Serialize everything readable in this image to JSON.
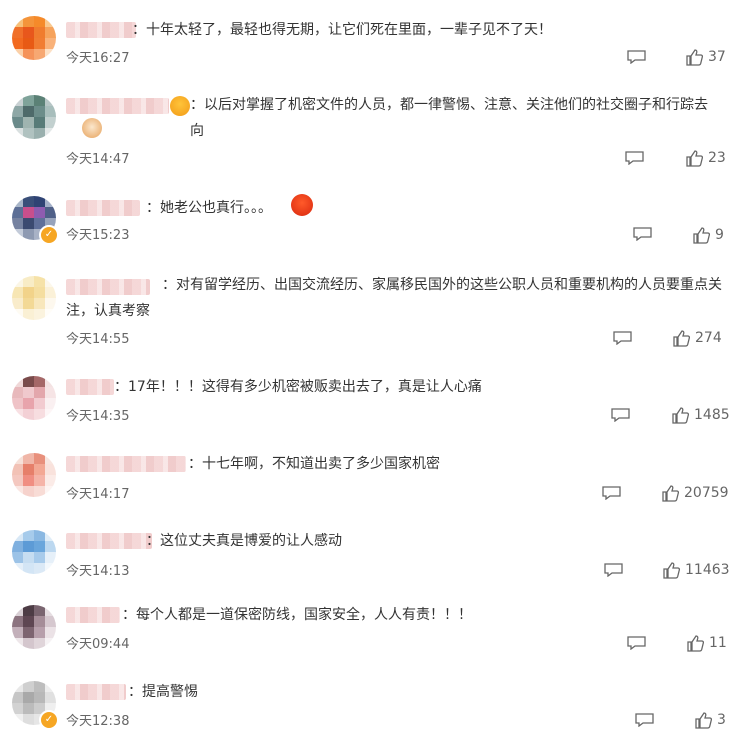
{
  "comments": [
    {
      "text": "：十年太轻了，最轻也得无期，让它们死在里面，一辈子见不了天！",
      "time": "今天16:27",
      "likes": "37"
    },
    {
      "text": "：以后对掌握了机密文件的人员，都一律警惕、注意、关注他们的社交圈子和行踪去向",
      "time": "今天14:47",
      "likes": "23"
    },
    {
      "text": "：她老公也真行。。。",
      "time": "今天15:23",
      "likes": "9"
    },
    {
      "text": "：对有留学经历、出国交流经历、家属移民国外的这些公职人员和重要机构的人员要重点关注，认真考察",
      "time": "今天14:55",
      "likes": "274"
    },
    {
      "text": "：17年！！！这得有多少机密被贩卖出去了，真是让人心痛",
      "time": "今天14:35",
      "likes": "1485"
    },
    {
      "text": "：十七年啊，不知道出卖了多少国家机密",
      "time": "今天14:17",
      "likes": "20759"
    },
    {
      "text": "：这位丈夫真是博爱的让人感动",
      "time": "今天14:13",
      "likes": "11463"
    },
    {
      "text": "：每个人都是一道保密防线，国家安全，人人有责！！！",
      "time": "今天09:44",
      "likes": "11"
    },
    {
      "text": "：提高警惕",
      "time": "今天12:38",
      "likes": "3"
    }
  ],
  "icons": {
    "reply": "comment-bubble-icon",
    "like": "thumbs-up-icon",
    "verified": "verified-badge-icon"
  },
  "colors": {
    "text": "#333333",
    "meta": "#666666",
    "verified": "#f6a623"
  }
}
